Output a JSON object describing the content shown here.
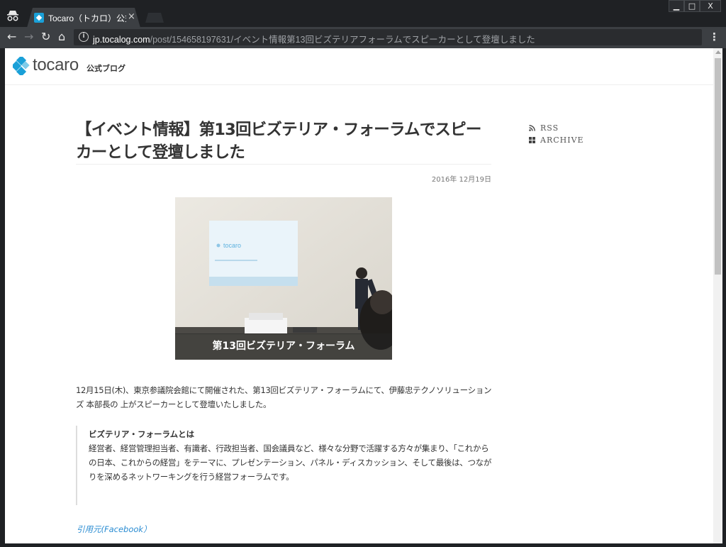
{
  "browser": {
    "tab_title": "Tocaro（トカロ）公式ブ",
    "close_glyph": "×",
    "window_controls": {
      "minimize": "▁",
      "maximize": "□",
      "close": "X"
    },
    "url_host": "jp.tocalog.com",
    "url_path": "/post/154658197631/イベント情報第13回ビズテリアフォーラムでスピーカーとして登壇しました",
    "menu_glyph": "⋮",
    "nav": {
      "back": "←",
      "forward": "→",
      "reload": "↻",
      "home": "⌂"
    }
  },
  "site": {
    "logo_text": "tocaro",
    "logo_sub": "公式ブログ",
    "brand_color": "#1aa0d8"
  },
  "post": {
    "title": "【イベント情報】第13回ビズテリア・フォーラムでスピーカーとして登壇しました",
    "date": "2016年 12月19日",
    "image_caption": "第13回ビズテリア・フォーラム",
    "screen_logo": "tocaro",
    "paragraph": "12月15日(木)、東京参議院会館にて開催された、第13回ビズテリア・フォーラムにて、伊藤忠テクノソリューションズ 本部長の 上がスピーカーとして登壇いたしました。",
    "quote_title": "ビズテリア・フォーラムとは",
    "quote_body": "経営者、経営管理担当者、有識者、行政担当者、国会議員など、様々な分野で活躍する方々が集まり、「これからの日本、これからの経営」をテーマに、プレゼンテーション、パネル・ディスカッション、そして最後は、つながりを深めるネットワーキングを行う経営フォーラムです。",
    "source_link": "引用元(Facebook）"
  },
  "sidebar": {
    "rss": "RSS",
    "archive": "ARCHIVE"
  }
}
